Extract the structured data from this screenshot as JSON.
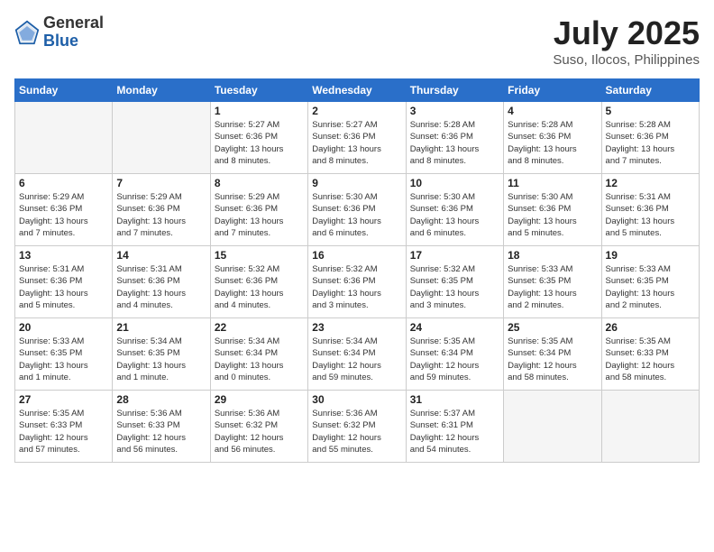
{
  "logo": {
    "general": "General",
    "blue": "Blue"
  },
  "title": "July 2025",
  "location": "Suso, Ilocos, Philippines",
  "days_of_week": [
    "Sunday",
    "Monday",
    "Tuesday",
    "Wednesday",
    "Thursday",
    "Friday",
    "Saturday"
  ],
  "weeks": [
    [
      {
        "day": "",
        "info": ""
      },
      {
        "day": "",
        "info": ""
      },
      {
        "day": "1",
        "info": "Sunrise: 5:27 AM\nSunset: 6:36 PM\nDaylight: 13 hours\nand 8 minutes."
      },
      {
        "day": "2",
        "info": "Sunrise: 5:27 AM\nSunset: 6:36 PM\nDaylight: 13 hours\nand 8 minutes."
      },
      {
        "day": "3",
        "info": "Sunrise: 5:28 AM\nSunset: 6:36 PM\nDaylight: 13 hours\nand 8 minutes."
      },
      {
        "day": "4",
        "info": "Sunrise: 5:28 AM\nSunset: 6:36 PM\nDaylight: 13 hours\nand 8 minutes."
      },
      {
        "day": "5",
        "info": "Sunrise: 5:28 AM\nSunset: 6:36 PM\nDaylight: 13 hours\nand 7 minutes."
      }
    ],
    [
      {
        "day": "6",
        "info": "Sunrise: 5:29 AM\nSunset: 6:36 PM\nDaylight: 13 hours\nand 7 minutes."
      },
      {
        "day": "7",
        "info": "Sunrise: 5:29 AM\nSunset: 6:36 PM\nDaylight: 13 hours\nand 7 minutes."
      },
      {
        "day": "8",
        "info": "Sunrise: 5:29 AM\nSunset: 6:36 PM\nDaylight: 13 hours\nand 7 minutes."
      },
      {
        "day": "9",
        "info": "Sunrise: 5:30 AM\nSunset: 6:36 PM\nDaylight: 13 hours\nand 6 minutes."
      },
      {
        "day": "10",
        "info": "Sunrise: 5:30 AM\nSunset: 6:36 PM\nDaylight: 13 hours\nand 6 minutes."
      },
      {
        "day": "11",
        "info": "Sunrise: 5:30 AM\nSunset: 6:36 PM\nDaylight: 13 hours\nand 5 minutes."
      },
      {
        "day": "12",
        "info": "Sunrise: 5:31 AM\nSunset: 6:36 PM\nDaylight: 13 hours\nand 5 minutes."
      }
    ],
    [
      {
        "day": "13",
        "info": "Sunrise: 5:31 AM\nSunset: 6:36 PM\nDaylight: 13 hours\nand 5 minutes."
      },
      {
        "day": "14",
        "info": "Sunrise: 5:31 AM\nSunset: 6:36 PM\nDaylight: 13 hours\nand 4 minutes."
      },
      {
        "day": "15",
        "info": "Sunrise: 5:32 AM\nSunset: 6:36 PM\nDaylight: 13 hours\nand 4 minutes."
      },
      {
        "day": "16",
        "info": "Sunrise: 5:32 AM\nSunset: 6:36 PM\nDaylight: 13 hours\nand 3 minutes."
      },
      {
        "day": "17",
        "info": "Sunrise: 5:32 AM\nSunset: 6:35 PM\nDaylight: 13 hours\nand 3 minutes."
      },
      {
        "day": "18",
        "info": "Sunrise: 5:33 AM\nSunset: 6:35 PM\nDaylight: 13 hours\nand 2 minutes."
      },
      {
        "day": "19",
        "info": "Sunrise: 5:33 AM\nSunset: 6:35 PM\nDaylight: 13 hours\nand 2 minutes."
      }
    ],
    [
      {
        "day": "20",
        "info": "Sunrise: 5:33 AM\nSunset: 6:35 PM\nDaylight: 13 hours\nand 1 minute."
      },
      {
        "day": "21",
        "info": "Sunrise: 5:34 AM\nSunset: 6:35 PM\nDaylight: 13 hours\nand 1 minute."
      },
      {
        "day": "22",
        "info": "Sunrise: 5:34 AM\nSunset: 6:34 PM\nDaylight: 13 hours\nand 0 minutes."
      },
      {
        "day": "23",
        "info": "Sunrise: 5:34 AM\nSunset: 6:34 PM\nDaylight: 12 hours\nand 59 minutes."
      },
      {
        "day": "24",
        "info": "Sunrise: 5:35 AM\nSunset: 6:34 PM\nDaylight: 12 hours\nand 59 minutes."
      },
      {
        "day": "25",
        "info": "Sunrise: 5:35 AM\nSunset: 6:34 PM\nDaylight: 12 hours\nand 58 minutes."
      },
      {
        "day": "26",
        "info": "Sunrise: 5:35 AM\nSunset: 6:33 PM\nDaylight: 12 hours\nand 58 minutes."
      }
    ],
    [
      {
        "day": "27",
        "info": "Sunrise: 5:35 AM\nSunset: 6:33 PM\nDaylight: 12 hours\nand 57 minutes."
      },
      {
        "day": "28",
        "info": "Sunrise: 5:36 AM\nSunset: 6:33 PM\nDaylight: 12 hours\nand 56 minutes."
      },
      {
        "day": "29",
        "info": "Sunrise: 5:36 AM\nSunset: 6:32 PM\nDaylight: 12 hours\nand 56 minutes."
      },
      {
        "day": "30",
        "info": "Sunrise: 5:36 AM\nSunset: 6:32 PM\nDaylight: 12 hours\nand 55 minutes."
      },
      {
        "day": "31",
        "info": "Sunrise: 5:37 AM\nSunset: 6:31 PM\nDaylight: 12 hours\nand 54 minutes."
      },
      {
        "day": "",
        "info": ""
      },
      {
        "day": "",
        "info": ""
      }
    ]
  ]
}
